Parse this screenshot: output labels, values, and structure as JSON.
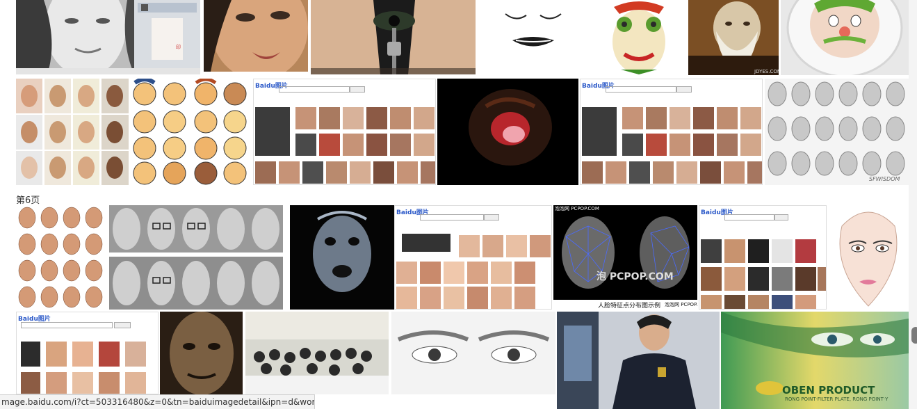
{
  "page_label": "第6页",
  "status_url": "mage.baidu.com/i?ct=503316480&z=0&tn=baiduimagedetail&ipn=d&wor...",
  "captions": {
    "baidu_logo": "Baidu图片",
    "pcpop_top": "泡泡网 PCPOP.COM",
    "pcpop_mid": "泡 PCPOP.COM",
    "pcpop_bottom_left": "人脸特征点分布图示例",
    "pcpop_bottom_right": "泡泡网 PCPOP.COM",
    "oben_title": "OBEN PRODUCT",
    "oben_sub": "RONG POINT·FILTER PLATE, RONG POINT·Y",
    "sfwisdom": "SFWISDOM",
    "search_button": "百度一下"
  },
  "colors": {
    "baidu_blue": "#2a58c8",
    "baidu_red": "#d32f2f",
    "status_bg": "#f3f3f3"
  }
}
